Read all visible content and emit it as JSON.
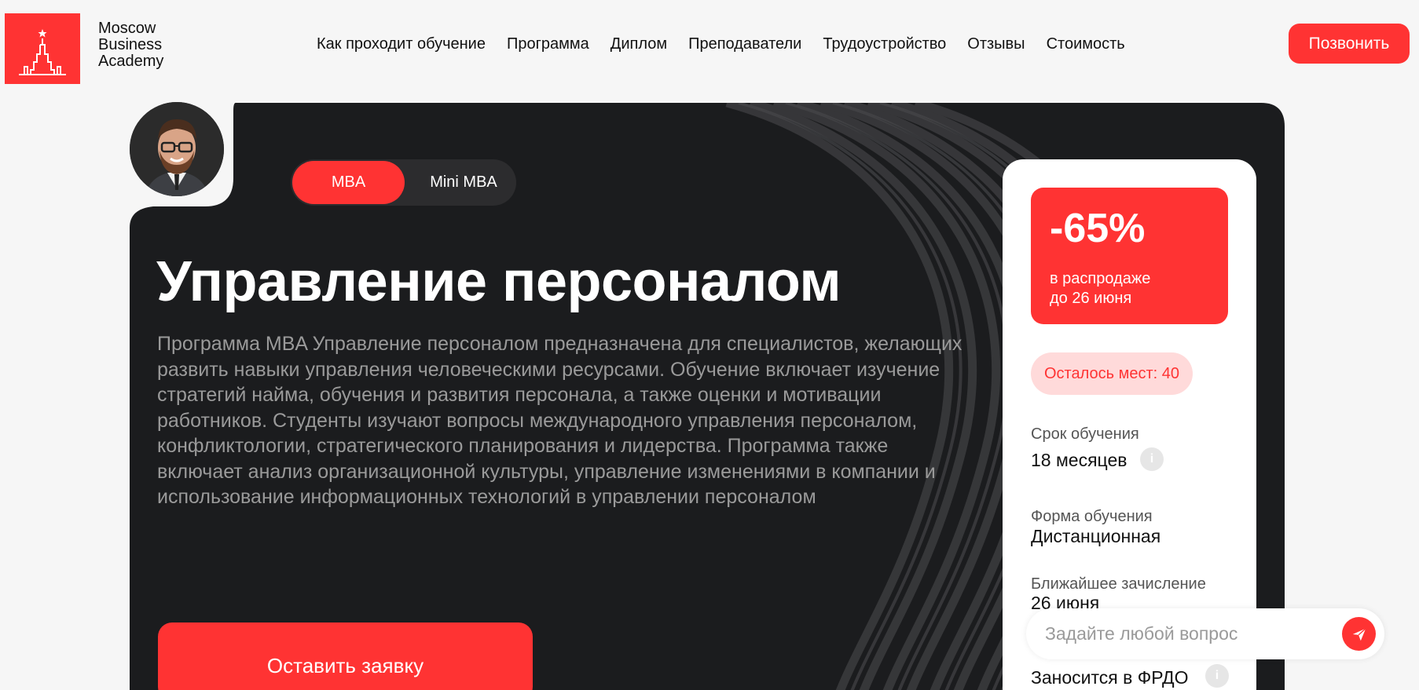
{
  "header": {
    "logo_lines": [
      "Moscow",
      "Business",
      "Academy"
    ],
    "nav": [
      "Как проходит обучение",
      "Программа",
      "Диплом",
      "Преподаватели",
      "Трудоустройство",
      "Отзывы",
      "Стоимость"
    ],
    "call_label": "Позвонить"
  },
  "hero": {
    "toggle": {
      "active": "MBA",
      "inactive": "Mini MBA"
    },
    "title": "Управление персоналом",
    "description": "Программа MBA Управление персоналом предназначена для специалистов, желающих развить навыки управления человеческими ресурсами. Обучение включает изучение стратегий найма, обучения и развития персонала, а также оценки и мотивации работников. Студенты изучают вопросы международного управления персоналом, конфликтологии, стратегического планирования и лидерства. Программа также включает анализ организационной культуры, управление изменениями в компании и использование информационных технологий в управлении персоналом",
    "apply_label": "Оставить заявку"
  },
  "side": {
    "discount": "-65%",
    "sale_line1": "в распродаже",
    "sale_line2": "до 26 июня",
    "seats": "Осталось мест: 40",
    "duration_label": "Срок обучения",
    "duration_value": "18 месяцев",
    "format_label": "Форма обучения",
    "format_value": "Дистанционная",
    "enroll_label": "Ближайшее зачисление",
    "enroll_value": "26 июня",
    "diploma_value": "Заносится в ФРДО"
  },
  "chat": {
    "placeholder": "Задайте любой вопрос"
  },
  "colors": {
    "accent": "#ff3333",
    "dark": "#1b1c1e",
    "seats_bg": "#ffdada"
  }
}
